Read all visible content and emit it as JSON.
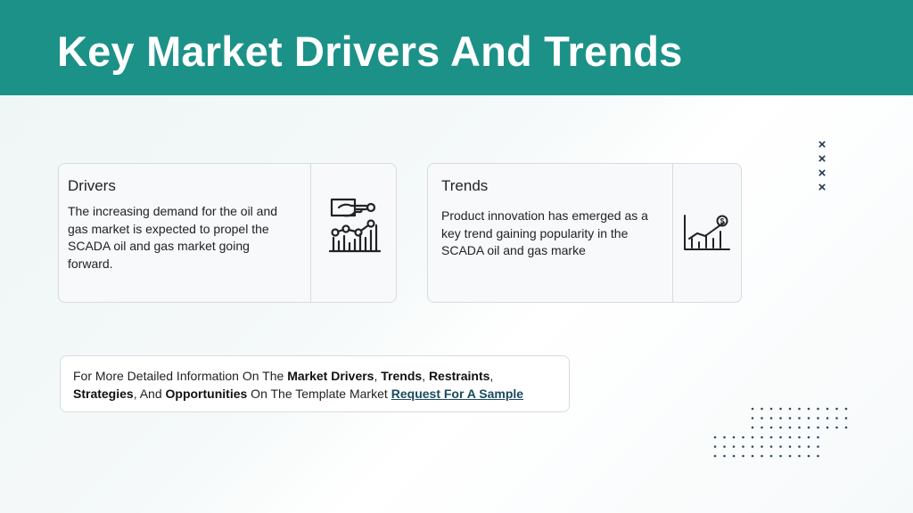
{
  "header": {
    "title": "Key Market Drivers And Trends",
    "background": "#1c9188"
  },
  "drivers": {
    "title": "Drivers",
    "body": "The increasing demand for the oil and gas market is expected to propel the SCADA oil and gas market going forward.",
    "icon": "hand-pointing-chart-icon"
  },
  "trends": {
    "title": "Trends",
    "body": "Product innovation has emerged as a key trend gaining popularity in the SCADA oil and gas marke",
    "icon": "growth-chart-dollar-icon"
  },
  "decor": {
    "x_marks": [
      "×",
      "×",
      "×",
      "×"
    ],
    "x_color": "#1e3550"
  },
  "info": {
    "prefix": "For More Detailed Information On The ",
    "market_drivers": "Market Drivers",
    "sep1": ", ",
    "trends": "Trends",
    "sep2": ", ",
    "restraints": "Restraints",
    "sep3": ",",
    "strategies": "Strategies",
    "sep4": ", And ",
    "opportunities": "Opportunities",
    "suffix": " On The Template Market",
    "link": "Request For A Sample"
  }
}
